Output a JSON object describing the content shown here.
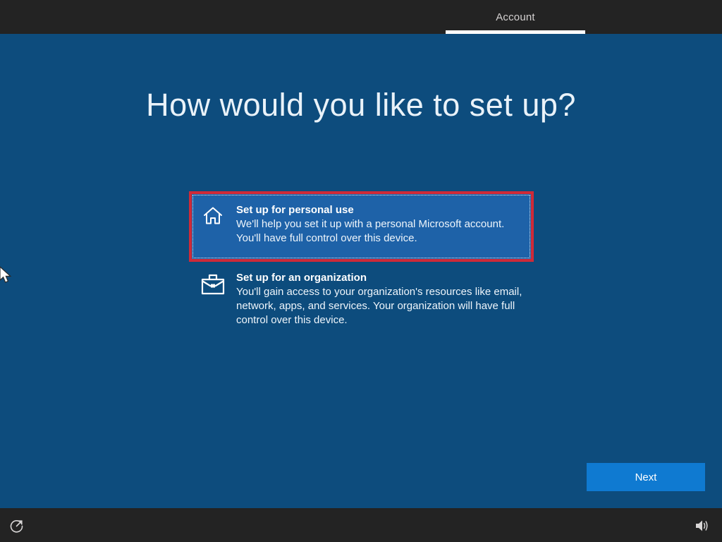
{
  "header": {
    "tab_label": "Account"
  },
  "main": {
    "title": "How would you like to set up?",
    "options": [
      {
        "id": "personal",
        "title": "Set up for personal use",
        "description_lines": [
          "We'll help you set it up with a personal Microsoft account.",
          "You'll have full control over this device."
        ],
        "icon": "home-icon",
        "selected": true
      },
      {
        "id": "organization",
        "title": "Set up for an organization",
        "description_lines": [
          "You'll gain access to your organization's resources like email,",
          "network, apps, and services. Your organization will have full",
          "control over this device."
        ],
        "icon": "briefcase-icon",
        "selected": false
      }
    ],
    "next_button_label": "Next"
  },
  "footer": {
    "left_icon": "ease-of-access-icon",
    "right_icon": "volume-icon"
  },
  "colors": {
    "top_bar": "#232323",
    "background": "#0d4c7d",
    "option_selected_fill": "#1e62a8",
    "selection_border": "#cf2a38",
    "next_button": "#0f7ad1",
    "tab_underline": "#ffffff",
    "text": "#ffffff"
  }
}
